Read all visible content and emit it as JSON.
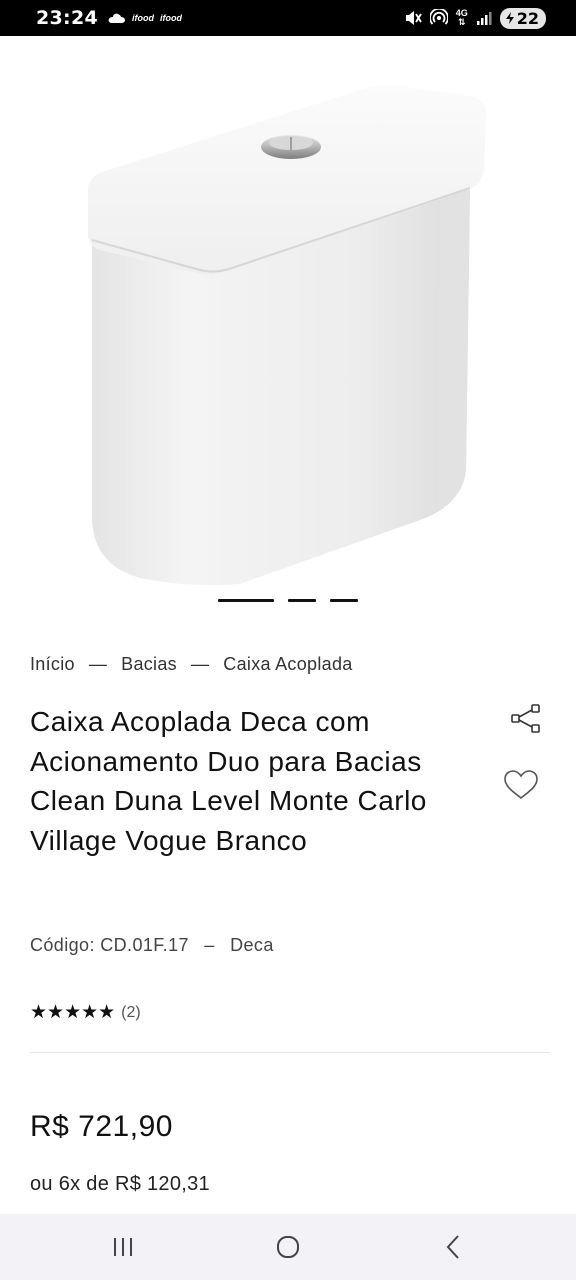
{
  "status_bar": {
    "time": "23:24",
    "left_icons": [
      "cloud-icon",
      "ifood",
      "ifood"
    ],
    "ifood_label": "ifood",
    "network_label": "4G",
    "battery": "22"
  },
  "carousel": {
    "active_index": 0,
    "count": 3
  },
  "breadcrumb": {
    "items": [
      "Início",
      "Bacias",
      "Caixa Acoplada"
    ],
    "separator": "—"
  },
  "product": {
    "title": "Caixa Acoplada Deca com Acionamento Duo para Bacias Clean Duna Level Monte Carlo Village Vogue Branco",
    "code_label": "Código: CD.01F.17",
    "code_separator": "–",
    "brand": "Deca",
    "stars": "★★★★★",
    "rating_value": 5,
    "rating_count": "(2)",
    "price": "R$ 721,90",
    "installments": "ou 6x de R$ 120,31"
  },
  "actions": {
    "share_icon": "share-icon",
    "favorite_icon": "heart-icon"
  },
  "nav": {
    "recent_icon": "recents-icon",
    "home_icon": "home-icon",
    "back_icon": "back-icon"
  }
}
